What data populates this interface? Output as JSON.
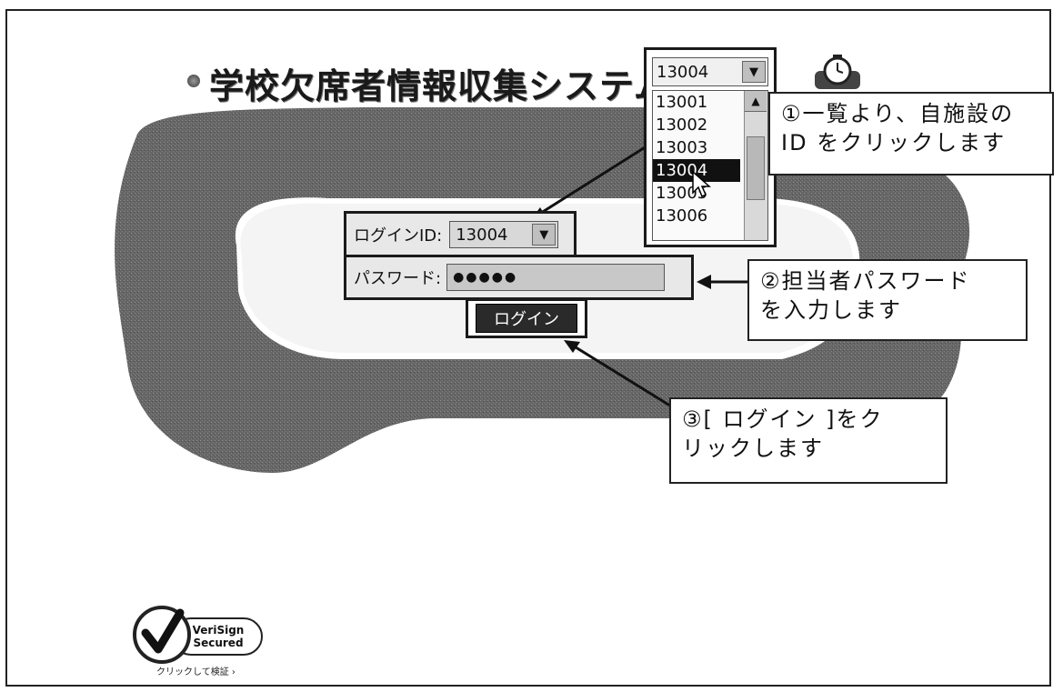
{
  "page": {
    "title": "学校欠席者情報収集システム"
  },
  "login": {
    "id_label": "ログインID:",
    "id_value": "13004",
    "password_label": "パスワード:",
    "password_value": "●●●●●",
    "login_button": "ログイン"
  },
  "dropdown": {
    "selected": "13004",
    "options": [
      "13001",
      "13002",
      "13003",
      "13004",
      "13005",
      "13006"
    ],
    "highlighted_index": 3
  },
  "callouts": {
    "step1": {
      "line1": "①一覧より、自施設の",
      "line2": "ID をクリックします"
    },
    "step2": {
      "line1": "②担当者パスワード",
      "line2": "を入力します"
    },
    "step3": {
      "line1": "③[ ログイン ]をク",
      "line2": "リックします"
    }
  },
  "badge": {
    "brand_line1": "VeriSign",
    "brand_line2": "Secured",
    "caption": "クリックして検証 ›"
  },
  "icons": {
    "dropdown_arrow": "chevron-down-icon",
    "scroll_up": "chevron-up-icon",
    "cursor": "mouse-pointer-icon",
    "clock": "clock-icon",
    "checkmark": "checkmark-icon"
  },
  "colors": {
    "frame": "#222222",
    "background_band": "#5a5a5a",
    "selected_item": "#111111"
  }
}
